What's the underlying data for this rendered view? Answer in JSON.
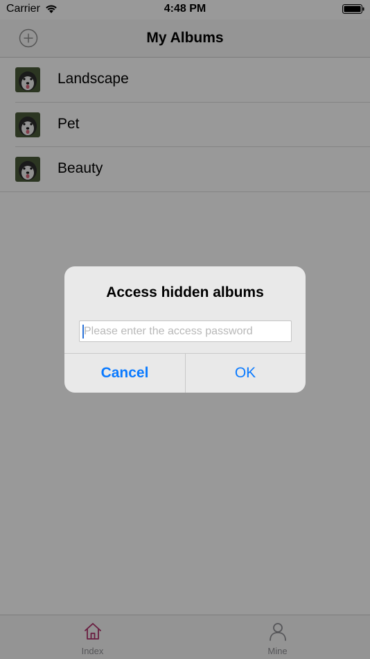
{
  "status_bar": {
    "carrier": "Carrier",
    "time": "4:48 PM"
  },
  "nav": {
    "title": "My Albums",
    "add_icon": "plus-circle-icon"
  },
  "albums": [
    {
      "label": "Landscape",
      "thumb_icon": "dog-photo-thumbnail"
    },
    {
      "label": "Pet",
      "thumb_icon": "dog-photo-thumbnail"
    },
    {
      "label": "Beauty",
      "thumb_icon": "dog-photo-thumbnail"
    }
  ],
  "alert": {
    "title": "Access hidden albums",
    "input_value": "",
    "input_placeholder": "Please enter the access password",
    "cancel_label": "Cancel",
    "ok_label": "OK"
  },
  "tab_bar": {
    "tabs": [
      {
        "label": "Index",
        "icon": "home-icon",
        "selected": true
      },
      {
        "label": "Mine",
        "icon": "person-icon",
        "selected": false
      }
    ]
  },
  "colors": {
    "accent_blue": "#0a7aff",
    "tab_selected": "#b0306b",
    "tab_unselected": "#8e8e93"
  }
}
